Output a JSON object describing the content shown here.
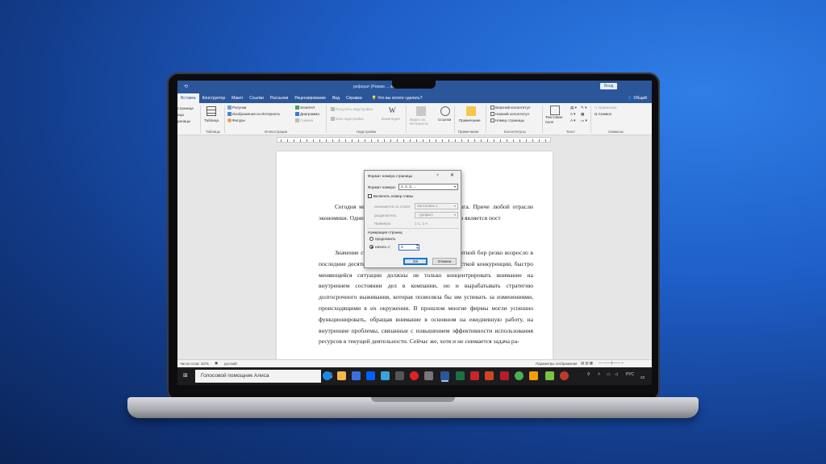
{
  "window": {
    "title": "реферат (Режим ... ности) - Word",
    "login": "Вход",
    "quick_access": "⟲"
  },
  "tabs": [
    {
      "label": "Вставка",
      "active": true
    },
    {
      "label": "Конструктор"
    },
    {
      "label": "Макет"
    },
    {
      "label": "Ссылки"
    },
    {
      "label": "Рассылки"
    },
    {
      "label": "Рецензирование"
    },
    {
      "label": "Вид"
    },
    {
      "label": "Справка"
    }
  ],
  "tell_me": "Что вы хотите сделать?",
  "share": "Общий",
  "ribbon": {
    "pages_cut": [
      "страница",
      "ица",
      "раницы"
    ],
    "table": "Таблица",
    "tables_group": "Таблицы",
    "pictures": "Рисунки",
    "online_pictures": "Изображения из Интернета",
    "shapes": "Фигуры",
    "smartart": "SmartArt",
    "chart": "Диаграмма",
    "screenshot": "Снимок",
    "illustrations_group": "Иллюстрации",
    "get_addins": "Получить надстройки",
    "my_addins": "Мои надстройки",
    "wikipedia": "Википедия",
    "addins_group": "Надстройки",
    "online_video": "Видео из Интернета",
    "links": "Ссылки",
    "comment": "Примечание",
    "comments_group": "Примечания",
    "header": "Верхний колонтитул",
    "footer": "Нижний колонтитул",
    "page_number": "Номер страницы",
    "header_footer_group": "Колонтитулы",
    "textbox": "Текстовое поле",
    "text_group": "Текст",
    "equation": "Уравнение",
    "symbol": "Символ",
    "symbols_group": "Символы"
  },
  "document": {
    "para1": "Сегодня ми                                         ципиально важную роль маркетинга. Приче                               любой отрасли экономики. Одним из важ                              маркетинговой деятельности является пост",
    "para2": "Значение ст                                        ющего фирме выживать в конкурентной бор                              резко возросло в последние десятилетия. Все компании в условиях жесткой конкуренции, быстро меняющейся ситуации должны не только концентрировать внимание на внутреннем состоянии дел в компании, но и вырабатывать стратегию долгосрочного выживания, которая позволяла бы им успевать за изменениями, происходящими в их окружении. В прошлом многие фирмы могли успешно функционировать, обращая внимание в основном на ежедневную работу, на внутренние проблемы, связанные с повышением эффективности использования ресурсов в текущей деятельности. Сейчас же, хотя и не снимается задача ра-"
  },
  "statusbar": {
    "words": "Число слов: 3376",
    "lang": "русский",
    "display": "Параметры отображения"
  },
  "dialog": {
    "title": "Формат номера страницы",
    "help": "?",
    "close": "✕",
    "format_label": "Формат номера:",
    "format_value": "1, 2, 3, ...",
    "include_chapter": "Включить номер главы",
    "chapter_starts_label": "начинается со стиля:",
    "chapter_starts_value": "Заголовок 1",
    "separator_label": "разделитель:",
    "separator_value": "-   (дефис)",
    "examples_label": "Примеры:",
    "examples_value": "1-1, 1-A",
    "numbering_section": "Нумерация страниц",
    "continue": "продолжить",
    "start_at": "начать с:",
    "start_value": "3",
    "ok": "ОК",
    "cancel": "Отмена"
  },
  "taskbar": {
    "search_text": "Голосовой помощник Алиса",
    "lang": "РУС",
    "clock": "23"
  },
  "colors": {
    "word_blue": "#2b579a",
    "taskbar": "#1c1c1e"
  }
}
